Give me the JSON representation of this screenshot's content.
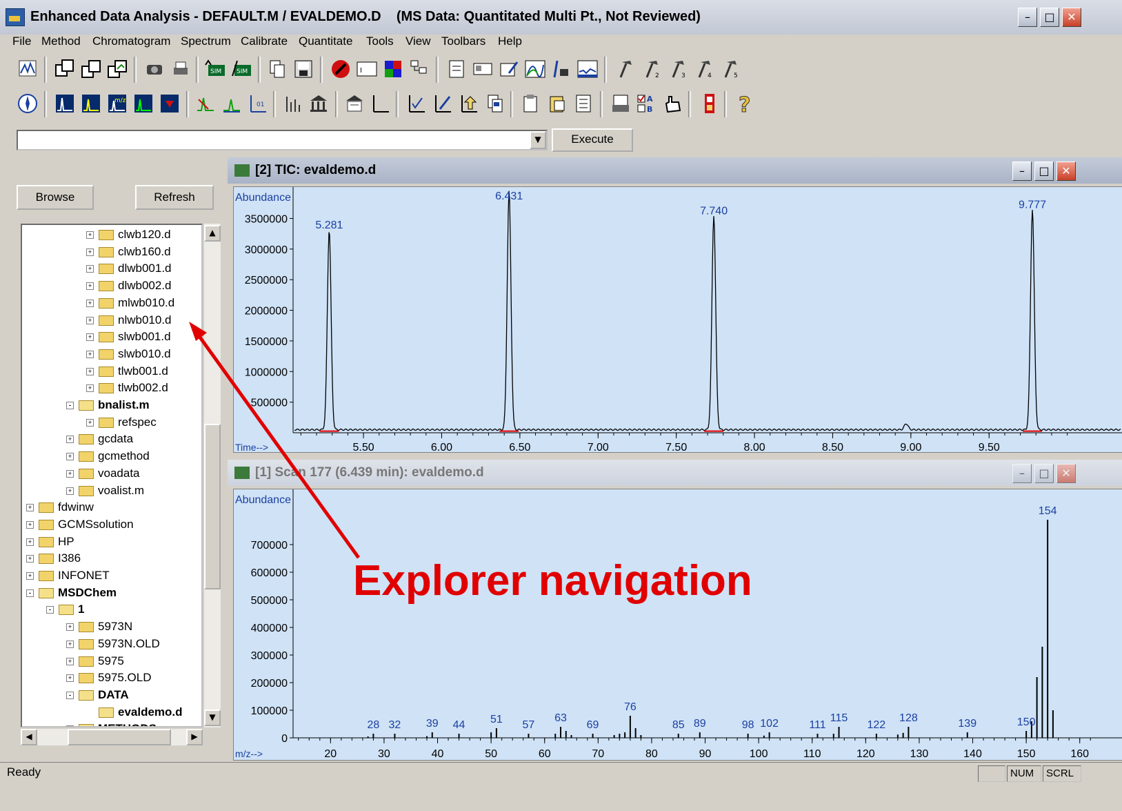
{
  "window": {
    "title": "Enhanced Data Analysis - DEFAULT.M / EVALDEMO.D    (MS Data: Quantitated Multi Pt., Not Reviewed)"
  },
  "menu": [
    "File",
    "Method",
    "Chromatogram",
    "Spectrum",
    "Calibrate",
    "Quantitate",
    "Tools",
    "View",
    "Toolbars",
    "Help"
  ],
  "command": {
    "value": "",
    "execute_label": "Execute"
  },
  "explorer": {
    "browse_label": "Browse",
    "refresh_label": "Refresh",
    "tree": [
      {
        "label": "clwb120.d",
        "depth": 3,
        "expander": "+",
        "bold": false,
        "open": false
      },
      {
        "label": "clwb160.d",
        "depth": 3,
        "expander": "+",
        "bold": false,
        "open": false
      },
      {
        "label": "dlwb001.d",
        "depth": 3,
        "expander": "+",
        "bold": false,
        "open": false
      },
      {
        "label": "dlwb002.d",
        "depth": 3,
        "expander": "+",
        "bold": false,
        "open": false
      },
      {
        "label": "mlwb010.d",
        "depth": 3,
        "expander": "+",
        "bold": false,
        "open": false
      },
      {
        "label": "nlwb010.d",
        "depth": 3,
        "expander": "+",
        "bold": false,
        "open": false
      },
      {
        "label": "slwb001.d",
        "depth": 3,
        "expander": "+",
        "bold": false,
        "open": false
      },
      {
        "label": "slwb010.d",
        "depth": 3,
        "expander": "+",
        "bold": false,
        "open": false
      },
      {
        "label": "tlwb001.d",
        "depth": 3,
        "expander": "+",
        "bold": false,
        "open": false
      },
      {
        "label": "tlwb002.d",
        "depth": 3,
        "expander": "+",
        "bold": false,
        "open": false
      },
      {
        "label": "bnalist.m",
        "depth": 2,
        "expander": "-",
        "bold": true,
        "open": true
      },
      {
        "label": "refspec",
        "depth": 3,
        "expander": "+",
        "bold": false,
        "open": false
      },
      {
        "label": "gcdata",
        "depth": 2,
        "expander": "+",
        "bold": false,
        "open": false
      },
      {
        "label": "gcmethod",
        "depth": 2,
        "expander": "+",
        "bold": false,
        "open": false
      },
      {
        "label": "voadata",
        "depth": 2,
        "expander": "+",
        "bold": false,
        "open": false
      },
      {
        "label": "voalist.m",
        "depth": 2,
        "expander": "+",
        "bold": false,
        "open": false
      },
      {
        "label": "fdwinw",
        "depth": 0,
        "expander": "+",
        "bold": false,
        "open": false
      },
      {
        "label": "GCMSsolution",
        "depth": 0,
        "expander": "+",
        "bold": false,
        "open": false
      },
      {
        "label": "HP",
        "depth": 0,
        "expander": "+",
        "bold": false,
        "open": false
      },
      {
        "label": "I386",
        "depth": 0,
        "expander": "+",
        "bold": false,
        "open": false
      },
      {
        "label": "INFONET",
        "depth": 0,
        "expander": "+",
        "bold": false,
        "open": false
      },
      {
        "label": "MSDChem",
        "depth": 0,
        "expander": "-",
        "bold": true,
        "open": true
      },
      {
        "label": "1",
        "depth": 1,
        "expander": "-",
        "bold": true,
        "open": true
      },
      {
        "label": "5973N",
        "depth": 2,
        "expander": "+",
        "bold": false,
        "open": false
      },
      {
        "label": "5973N.OLD",
        "depth": 2,
        "expander": "+",
        "bold": false,
        "open": false
      },
      {
        "label": "5975",
        "depth": 2,
        "expander": "+",
        "bold": false,
        "open": false
      },
      {
        "label": "5975.OLD",
        "depth": 2,
        "expander": "+",
        "bold": false,
        "open": false
      },
      {
        "label": "DATA",
        "depth": 2,
        "expander": "-",
        "bold": true,
        "open": true
      },
      {
        "label": "evaldemo.d",
        "depth": 3,
        "expander": "",
        "bold": true,
        "open": true
      },
      {
        "label": "METHODS",
        "depth": 2,
        "expander": "-",
        "bold": true,
        "open": true
      }
    ]
  },
  "tic_window": {
    "title": "[2] TIC: evaldemo.d"
  },
  "scan_window": {
    "title": "[1] Scan 177 (6.439 min): evaldemo.d"
  },
  "status": {
    "text": "Ready",
    "num": "NUM",
    "scrl": "SCRL"
  },
  "annotation": {
    "text": "Explorer navigation",
    "color": "#e10000"
  },
  "chart_data": [
    {
      "type": "line",
      "ylabel": "Abundance",
      "xlabel": "Time-->",
      "xlim": [
        5.05,
        10.05
      ],
      "ylim": [
        0,
        3900000
      ],
      "yticks": [
        500000,
        1000000,
        1500000,
        2000000,
        2500000,
        3000000,
        3500000
      ],
      "yticklabels": [
        "500000",
        "1000000",
        "1500000",
        "2000000",
        "2500000",
        "3000000",
        "3500000"
      ],
      "xticks": [
        5.5,
        6.0,
        6.5,
        7.0,
        7.5,
        8.0,
        8.5,
        9.0,
        9.5
      ],
      "xticklabels": [
        "5.50",
        "6.00",
        "6.50",
        "7.00",
        "7.50",
        "8.00",
        "8.50",
        "9.00",
        "9.50"
      ],
      "peaks": [
        {
          "rt": 5.281,
          "label": "5.281",
          "height": 3270000
        },
        {
          "rt": 6.431,
          "label": "6.431",
          "height": 3900000
        },
        {
          "rt": 7.74,
          "label": "7.740",
          "height": 3500000
        },
        {
          "rt": 9.777,
          "label": "9.777",
          "height": 3600000
        }
      ],
      "minor_peaks": [
        {
          "rt": 8.97,
          "height": 100000
        }
      ],
      "baseline": 50000
    },
    {
      "type": "bar",
      "ylabel": "Abundance",
      "xlabel": "m/z-->",
      "xlim": [
        13,
        163
      ],
      "ylim": [
        0,
        850000
      ],
      "yticks": [
        0,
        100000,
        200000,
        300000,
        400000,
        500000,
        600000,
        700000
      ],
      "yticklabels": [
        "0",
        "100000",
        "200000",
        "300000",
        "400000",
        "500000",
        "600000",
        "700000"
      ],
      "xticks": [
        20,
        30,
        40,
        50,
        60,
        70,
        80,
        90,
        100,
        110,
        120,
        130,
        140,
        150,
        160
      ],
      "xticklabels": [
        "20",
        "30",
        "40",
        "50",
        "60",
        "70",
        "80",
        "90",
        "100",
        "110",
        "120",
        "130",
        "140",
        "150",
        "160"
      ],
      "labels": [
        {
          "mz": 28,
          "label": "28",
          "value": 15000
        },
        {
          "mz": 32,
          "label": "32",
          "value": 15000
        },
        {
          "mz": 39,
          "label": "39",
          "value": 20000
        },
        {
          "mz": 44,
          "label": "44",
          "value": 15000
        },
        {
          "mz": 51,
          "label": "51",
          "value": 35000
        },
        {
          "mz": 57,
          "label": "57",
          "value": 15000
        },
        {
          "mz": 63,
          "label": "63",
          "value": 40000
        },
        {
          "mz": 69,
          "label": "69",
          "value": 15000
        },
        {
          "mz": 76,
          "label": "76",
          "value": 80000
        },
        {
          "mz": 85,
          "label": "85",
          "value": 15000
        },
        {
          "mz": 89,
          "label": "89",
          "value": 20000
        },
        {
          "mz": 98,
          "label": "98",
          "value": 15000
        },
        {
          "mz": 102,
          "label": "102",
          "value": 20000
        },
        {
          "mz": 111,
          "label": "111",
          "value": 15000
        },
        {
          "mz": 115,
          "label": "115",
          "value": 40000
        },
        {
          "mz": 122,
          "label": "122",
          "value": 15000
        },
        {
          "mz": 128,
          "label": "128",
          "value": 40000
        },
        {
          "mz": 139,
          "label": "139",
          "value": 20000
        },
        {
          "mz": 150,
          "label": "150",
          "value": 25000
        },
        {
          "mz": 154,
          "label": "154",
          "value": 790000
        }
      ],
      "extra_bars": [
        {
          "mz": 27,
          "value": 5000
        },
        {
          "mz": 38,
          "value": 6000
        },
        {
          "mz": 50,
          "value": 20000
        },
        {
          "mz": 62,
          "value": 15000
        },
        {
          "mz": 64,
          "value": 25000
        },
        {
          "mz": 65,
          "value": 10000
        },
        {
          "mz": 73,
          "value": 10000
        },
        {
          "mz": 74,
          "value": 15000
        },
        {
          "mz": 75,
          "value": 20000
        },
        {
          "mz": 77,
          "value": 35000
        },
        {
          "mz": 78,
          "value": 10000
        },
        {
          "mz": 101,
          "value": 8000
        },
        {
          "mz": 114,
          "value": 15000
        },
        {
          "mz": 126,
          "value": 12000
        },
        {
          "mz": 127,
          "value": 18000
        },
        {
          "mz": 151,
          "value": 60000
        },
        {
          "mz": 152,
          "value": 220000
        },
        {
          "mz": 153,
          "value": 330000
        },
        {
          "mz": 155,
          "value": 100000
        }
      ]
    }
  ]
}
